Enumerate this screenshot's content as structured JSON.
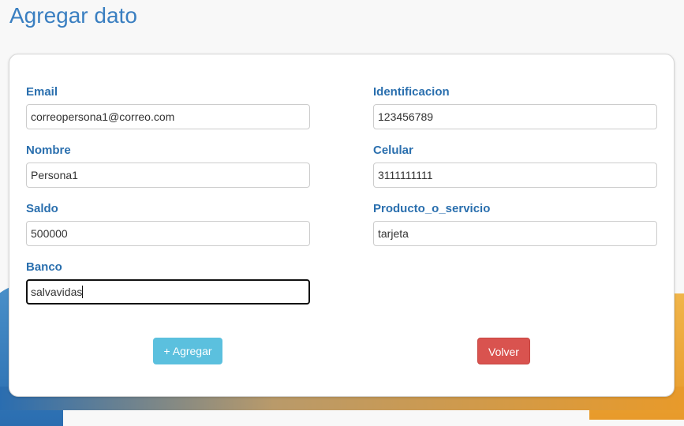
{
  "page": {
    "title": "Agregar dato"
  },
  "form": {
    "email": {
      "label": "Email",
      "value": "correopersona1@correo.com"
    },
    "identificacion": {
      "label": "Identificacion",
      "value": "123456789"
    },
    "nombre": {
      "label": "Nombre",
      "value": "Persona1"
    },
    "celular": {
      "label": "Celular",
      "value": "3111111111"
    },
    "saldo": {
      "label": "Saldo",
      "value": "500000"
    },
    "producto": {
      "label": "Producto_o_servicio",
      "value": "tarjeta"
    },
    "banco": {
      "label": "Banco",
      "value": "salvavidas"
    }
  },
  "buttons": {
    "add_label": "+ Agregar",
    "back_label": "Volver"
  },
  "colors": {
    "primary": "#3a7fc1",
    "label": "#2a6fae",
    "add": "#5bc0de",
    "back": "#d9534f"
  }
}
